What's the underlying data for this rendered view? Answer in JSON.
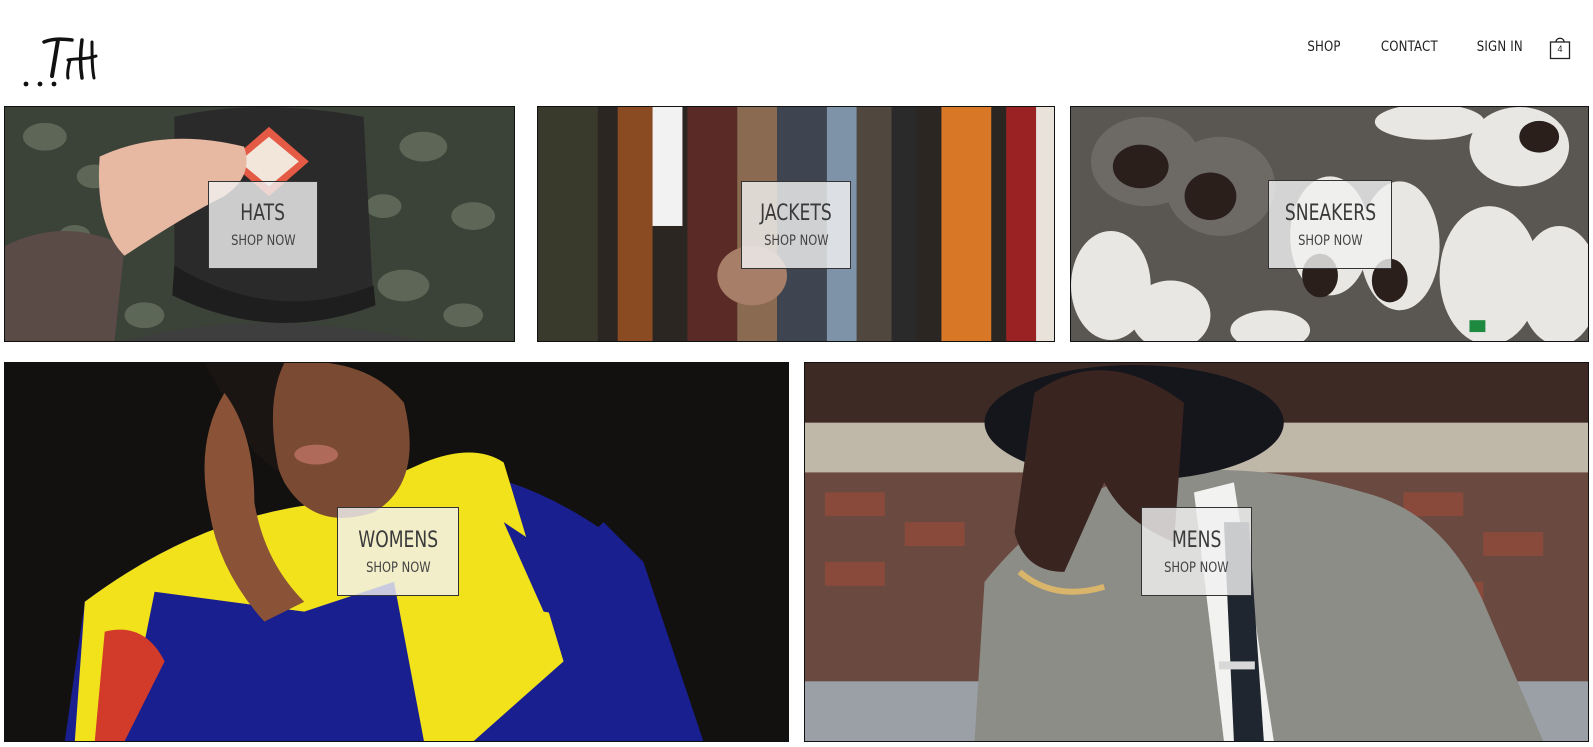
{
  "header": {
    "logo_alt": "TH",
    "nav": [
      "SHOP",
      "CONTACT",
      "SIGN IN"
    ],
    "cart": {
      "icon": "shopping-bag-icon",
      "count": "4"
    }
  },
  "categories": [
    {
      "title": "HATS",
      "cta": "SHOP NOW"
    },
    {
      "title": "JACKETS",
      "cta": "SHOP NOW"
    },
    {
      "title": "SNEAKERS",
      "cta": "SHOP NOW"
    },
    {
      "title": "WOMENS",
      "cta": "SHOP NOW"
    },
    {
      "title": "MENS",
      "cta": "SHOP NOW"
    }
  ]
}
